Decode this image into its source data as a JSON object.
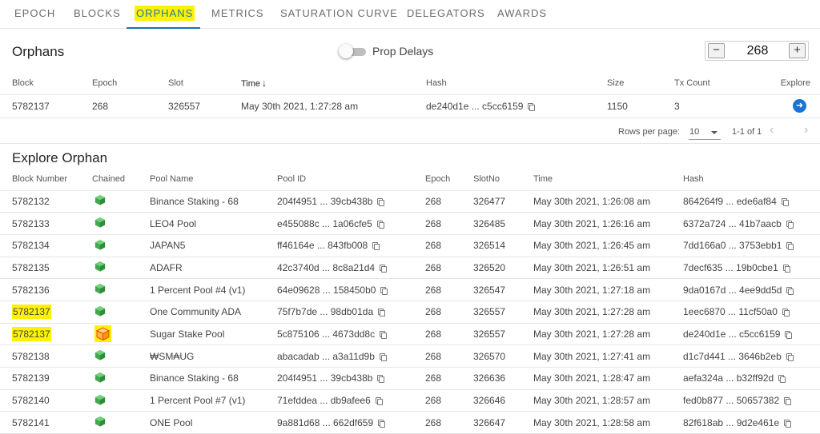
{
  "tabs": [
    {
      "label": "EPOCH",
      "active": false
    },
    {
      "label": "BLOCKS",
      "active": false
    },
    {
      "label": "ORPHANS",
      "active": true
    },
    {
      "label": "METRICS",
      "active": false
    },
    {
      "label": "SATURATION CURVE",
      "active": false
    },
    {
      "label": "DELEGATORS",
      "active": false
    },
    {
      "label": "AWARDS",
      "active": false
    }
  ],
  "orphans": {
    "title": "Orphans",
    "toggle_label": "Prop Delays",
    "toggle_on": false,
    "epoch_value": "268",
    "minus_label": "−",
    "plus_label": "+",
    "columns": [
      "Block",
      "Epoch",
      "Slot",
      "Time",
      "Hash",
      "Size",
      "Tx Count",
      "Explore"
    ],
    "sort_arrow": "↓",
    "rows": [
      {
        "block": "5782137",
        "epoch": "268",
        "slot": "326557",
        "time": "May 30th 2021, 1:27:28 am",
        "hash": "de240d1e ... c5cc6159",
        "size": "1150",
        "tx_count": "3",
        "explore_icon": "arrow-right-circle"
      }
    ]
  },
  "pagination": {
    "rows_per_page_label": "Rows per page:",
    "rows_per_page": "10",
    "range": "1-1 of 1",
    "prev": "‹",
    "next": "›"
  },
  "explore": {
    "title": "Explore Orphan",
    "columns": [
      "Block Number",
      "Chained",
      "Pool Name",
      "Pool ID",
      "Epoch",
      "SlotNo",
      "Time",
      "Hash"
    ],
    "rows": [
      {
        "block": "5782132",
        "chained": "green",
        "pool_name": "Binance Staking - 68",
        "pool_id": "204f4951 ... 39cb438b",
        "epoch": "268",
        "slot": "326477",
        "time": "May 30th 2021, 1:26:08 am",
        "hash": "864264f9 ... ede6af84",
        "highlight": false
      },
      {
        "block": "5782133",
        "chained": "green",
        "pool_name": "LEO4 Pool",
        "pool_id": "e455088c ... 1a06cfe5",
        "epoch": "268",
        "slot": "326485",
        "time": "May 30th 2021, 1:26:16 am",
        "hash": "6372a724 ... 41b7aacb",
        "highlight": false
      },
      {
        "block": "5782134",
        "chained": "green",
        "pool_name": "JAPAN5",
        "pool_id": "ff46164e ... 843fb008",
        "epoch": "268",
        "slot": "326514",
        "time": "May 30th 2021, 1:26:45 am",
        "hash": "7dd166a0 ... 3753ebb1",
        "highlight": false
      },
      {
        "block": "5782135",
        "chained": "green",
        "pool_name": "ADAFR",
        "pool_id": "42c3740d ... 8c8a21d4",
        "epoch": "268",
        "slot": "326520",
        "time": "May 30th 2021, 1:26:51 am",
        "hash": "7decf635 ... 19b0cbe1",
        "highlight": false
      },
      {
        "block": "5782136",
        "chained": "green",
        "pool_name": "1 Percent Pool #4 (v1)",
        "pool_id": "64e09628 ... 158450b0",
        "epoch": "268",
        "slot": "326547",
        "time": "May 30th 2021, 1:27:18 am",
        "hash": "9da0167d ... 4ee9dd5d",
        "highlight": false
      },
      {
        "block": "5782137",
        "chained": "green",
        "pool_name": "One Community ADA",
        "pool_id": "75f7b7de ... 98db01da",
        "epoch": "268",
        "slot": "326557",
        "time": "May 30th 2021, 1:27:28 am",
        "hash": "1eec6870 ... 11cf50a0",
        "highlight": true
      },
      {
        "block": "5782137",
        "chained": "orange",
        "pool_name": "Sugar Stake Pool",
        "pool_id": "5c875106 ... 4673dd8c",
        "epoch": "268",
        "slot": "326557",
        "time": "May 30th 2021, 1:27:28 am",
        "hash": "de240d1e ... c5cc6159",
        "highlight": true
      },
      {
        "block": "5782138",
        "chained": "green",
        "pool_name": "₩SM₳UG",
        "pool_id": "abacadab ... a3a11d9b",
        "epoch": "268",
        "slot": "326570",
        "time": "May 30th 2021, 1:27:41 am",
        "hash": "d1c7d441 ... 3646b2eb",
        "highlight": false
      },
      {
        "block": "5782139",
        "chained": "green",
        "pool_name": "Binance Staking - 68",
        "pool_id": "204f4951 ... 39cb438b",
        "epoch": "268",
        "slot": "326636",
        "time": "May 30th 2021, 1:28:47 am",
        "hash": "aefa324a ... b32ff92d",
        "highlight": false
      },
      {
        "block": "5782140",
        "chained": "green",
        "pool_name": "1 Percent Pool #7 (v1)",
        "pool_id": "71efddea ... db9afee6",
        "epoch": "268",
        "slot": "326646",
        "time": "May 30th 2021, 1:28:57 am",
        "hash": "fed0b877 ... 50657382",
        "highlight": false
      },
      {
        "block": "5782141",
        "chained": "green",
        "pool_name": "ONE Pool",
        "pool_id": "9a881d68 ... 662df659",
        "epoch": "268",
        "slot": "326647",
        "time": "May 30th 2021, 1:28:58 am",
        "hash": "82f618ab ... 9d2e461e",
        "highlight": false
      }
    ]
  },
  "colors": {
    "accent": "#1a73b8",
    "highlight": "#fff200",
    "chained_green": "#4caf50",
    "orphan_orange": "#f5a623",
    "explore_blue": "#1a73d6"
  }
}
